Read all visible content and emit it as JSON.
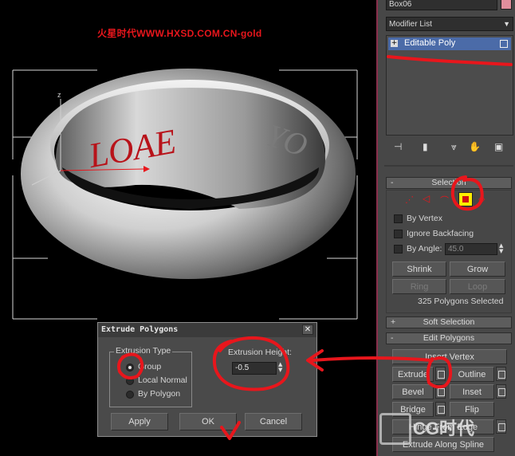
{
  "viewport": {
    "watermark": "火星时代WWW.HXSD.COM.CN-gold",
    "ring_text_front": "LOAE",
    "ring_text_back": "YO",
    "axis_z": "z"
  },
  "panel": {
    "object_name": "Box06",
    "modifier_list": "Modifier List",
    "stack_item": "Editable Poly",
    "selection": {
      "header": "Selection",
      "by_vertex": "By Vertex",
      "ignore_backfacing": "Ignore Backfacing",
      "by_angle": "By Angle:",
      "angle_value": "45.0",
      "shrink": "Shrink",
      "grow": "Grow",
      "ring": "Ring",
      "loop": "Loop",
      "status": "325 Polygons Selected"
    },
    "soft_selection": {
      "header": "Soft Selection"
    },
    "edit_polygons": {
      "header": "Edit Polygons",
      "insert_vertex": "Insert Vertex",
      "extrude": "Extrude",
      "outline": "Outline",
      "bevel": "Bevel",
      "inset": "Inset",
      "bridge": "Bridge",
      "flip": "Flip",
      "hinge_from_edge": "Hinge From Edge",
      "extrude_along_spline": "Extrude Along Spline"
    }
  },
  "dialog": {
    "title": "Extrude Polygons",
    "extrusion_type_label": "Extrusion Type",
    "options": [
      "Group",
      "Local Normal",
      "By Polygon"
    ],
    "selected_option": "Group",
    "extrusion_height_label": "Extrusion Height:",
    "extrusion_height_value": "-0.5",
    "apply": "Apply",
    "ok": "OK",
    "cancel": "Cancel"
  },
  "logo": "CG时代",
  "colors": {
    "annotation_red": "#e8161c",
    "panel_bg": "#474747",
    "selection_yellow": "#ffee00"
  }
}
